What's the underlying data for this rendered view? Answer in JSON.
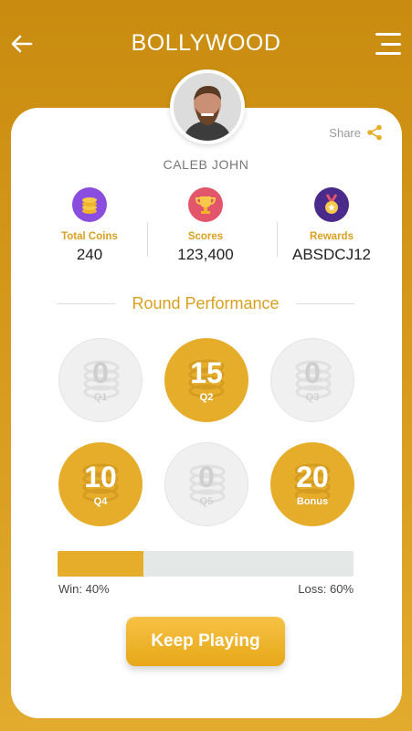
{
  "header": {
    "title": "BOLLYWOOD",
    "back_icon": "arrow-left-icon",
    "menu_icon": "hamburger-menu-icon"
  },
  "profile": {
    "name": "CALEB JOHN",
    "share_label": "Share"
  },
  "stats": [
    {
      "label": "Total Coins",
      "value": "240",
      "icon": "coins-icon",
      "color": "#8a4de0"
    },
    {
      "label": "Scores",
      "value": "123,400",
      "icon": "trophy-icon",
      "color": "#e2556a"
    },
    {
      "label": "Rewards",
      "value": "ABSDCJ12",
      "icon": "medal-icon",
      "color": "#4a2a8a"
    }
  ],
  "round_performance": {
    "title": "Round Performance",
    "rounds": [
      {
        "value": "0",
        "label": "Q1",
        "filled": false
      },
      {
        "value": "15",
        "label": "Q2",
        "filled": true
      },
      {
        "value": "0",
        "label": "Q3",
        "filled": false
      },
      {
        "value": "10",
        "label": "Q4",
        "filled": true
      },
      {
        "value": "0",
        "label": "Q5",
        "filled": false
      },
      {
        "value": "20",
        "label": "Bonus",
        "filled": true
      }
    ]
  },
  "progress": {
    "win_fraction": 0.29,
    "win_label": "Win: 40%",
    "loss_label": "Loss: 60%"
  },
  "actions": {
    "keep_playing_label": "Keep Playing"
  },
  "colors": {
    "accent": "#e5ad2a",
    "background": "#d79a1c"
  }
}
